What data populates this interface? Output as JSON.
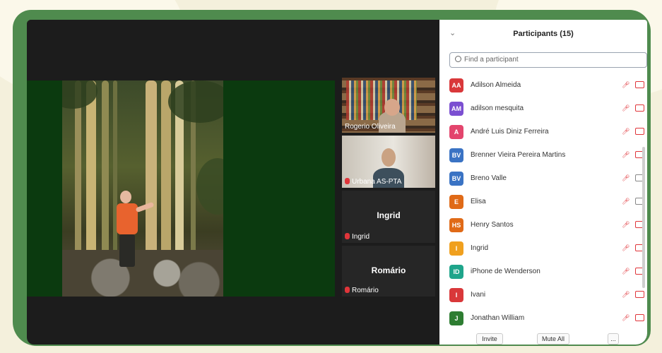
{
  "participants_panel": {
    "title": "Participants (15)",
    "search_placeholder": "Find a participant",
    "buttons": {
      "invite": "Invite",
      "mute_all": "Mute All",
      "more": "..."
    },
    "participants": [
      {
        "initials": "AA",
        "name": "Adilson Almeida",
        "color": "#d9383a",
        "mic": "muted",
        "cam": "off"
      },
      {
        "initials": "AM",
        "name": "adilson mesquita",
        "color": "#7b4fd1",
        "mic": "muted",
        "cam": "off"
      },
      {
        "initials": "A",
        "name": "André Luis Diniz Ferreira",
        "color": "#e3456d",
        "mic": "muted",
        "cam": "off"
      },
      {
        "initials": "BV",
        "name": "Brenner Vieira Pereira Martins",
        "color": "#3a73c4",
        "mic": "muted",
        "cam": "off"
      },
      {
        "initials": "BV",
        "name": "Breno Valle",
        "color": "#3a73c4",
        "mic": "muted",
        "cam": "on"
      },
      {
        "initials": "E",
        "name": "Elisa",
        "color": "#e06a17",
        "mic": "muted",
        "cam": "on"
      },
      {
        "initials": "HS",
        "name": "Henry Santos",
        "color": "#e06a17",
        "mic": "muted",
        "cam": "off"
      },
      {
        "initials": "I",
        "name": "Ingrid",
        "color": "#f0a01e",
        "mic": "muted",
        "cam": "off"
      },
      {
        "initials": "ID",
        "name": "iPhone de Wenderson",
        "color": "#1fa58b",
        "mic": "muted",
        "cam": "off"
      },
      {
        "initials": "I",
        "name": "Ivani",
        "color": "#d9383a",
        "mic": "muted",
        "cam": "off"
      },
      {
        "initials": "J",
        "name": "Jonathan William",
        "color": "#2e7d32",
        "mic": "muted",
        "cam": "off"
      }
    ]
  },
  "video_tiles": [
    {
      "name": "Rogerio Oliveira",
      "active": true
    },
    {
      "name": "Urbana AS-PTA",
      "active": false
    },
    {
      "name": "Ingrid",
      "big_name": "Ingrid",
      "active": false
    },
    {
      "name": "Romário",
      "big_name": "Romário",
      "active": false
    }
  ]
}
